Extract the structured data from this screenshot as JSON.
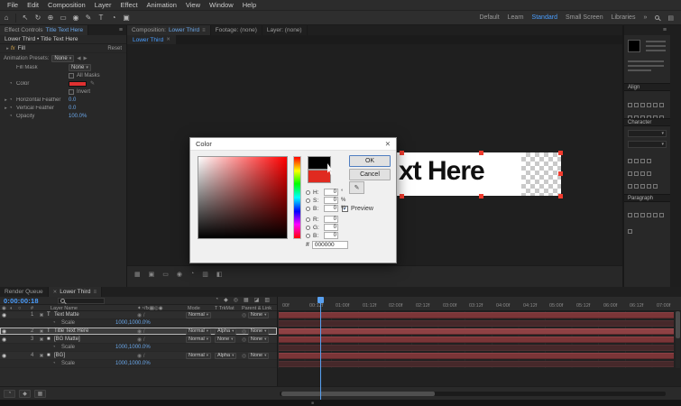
{
  "colors": {
    "accent": "#4a9eff",
    "fill_red": "#e03131",
    "dialog_current_red": "#e02a20",
    "timeline_bar": "#7b3537"
  },
  "icons": {
    "menu": "≡",
    "close": "✕",
    "dropdown": "▾",
    "twirl": "▸",
    "stopwatch": "◔",
    "eye": "◉",
    "audio": "◐",
    "solo": "○",
    "link": "◎",
    "prev": "◀",
    "next": "▶",
    "more": "»",
    "home": "⌂",
    "pointer": "↖",
    "rotate": "↻",
    "anchor": "⊕",
    "shape": "▭",
    "mask": "◉",
    "pen": "✎",
    "type": "T",
    "grid": "▣",
    "brush": "◔",
    "check": "✓",
    "eyedropper": "✎",
    "diamond": "◆",
    "box": "▦",
    "chart": "▥",
    "blend": "◧",
    "motion": "◪",
    "panel": "▤",
    "solid": "■"
  },
  "menubar": {
    "items": [
      "File",
      "Edit",
      "Composition",
      "Layer",
      "Effect",
      "Animation",
      "View",
      "Window",
      "Help"
    ]
  },
  "toolbar": {
    "workspaces": [
      "Default",
      "Learn",
      "Standard",
      "Small Screen",
      "Libraries"
    ],
    "active_workspace": "Standard"
  },
  "effect_controls": {
    "tab_label": "Effect Controls",
    "tab_target": "Title Text Here",
    "breadcrumb": "Lower Third • Title Text Here",
    "effect_badge": "fx",
    "effect_name": "Fill",
    "reset_label": "Reset",
    "presets_label": "Animation Presets:",
    "presets_value": "None",
    "props": {
      "fill_mask_label": "Fill Mask",
      "fill_mask_value": "None",
      "all_masks_label": "All Masks",
      "color_label": "Color",
      "invert_label": "Invert",
      "h_feather_label": "Horizontal Feather",
      "h_feather_value": "0.0",
      "v_feather_label": "Vertical Feather",
      "v_feather_value": "0.0",
      "opacity_label": "Opacity",
      "opacity_value": "100.0%"
    }
  },
  "comp_panel": {
    "tab_label": "Composition:",
    "tab_name": "Lower Third",
    "tab_footage": "Footage: (none)",
    "tab_layer": "Layer: (none)",
    "viewer_tab": "Lower Third",
    "canvas_text": "xt Here"
  },
  "right_panels": {
    "align": "Align",
    "character": "Character",
    "paragraph": "Paragraph"
  },
  "color_dialog": {
    "title": "Color",
    "ok": "OK",
    "cancel": "Cancel",
    "preview": "Preview",
    "hex_prefix": "#",
    "hex_value": "000000",
    "channels": [
      {
        "label": "H:",
        "value": "0",
        "unit": "°"
      },
      {
        "label": "S:",
        "value": "0",
        "unit": "%"
      },
      {
        "label": "B:",
        "value": "0",
        "unit": "%"
      },
      {
        "label": "R:",
        "value": "0",
        "unit": ""
      },
      {
        "label": "G:",
        "value": "0",
        "unit": ""
      },
      {
        "label": "B:",
        "value": "0",
        "unit": ""
      }
    ]
  },
  "timeline": {
    "tab_render_queue": "Render Queue",
    "tab_comp": "Lower Third",
    "timecode": "0:00:00:18",
    "columns": {
      "num": "#",
      "name": "Layer Name",
      "switches": "✦◔/fx▦◎◉",
      "mode": "Mode",
      "trkmat": "T TrkMat",
      "parent": "Parent & Link"
    },
    "row_switches": "◉ /",
    "layers": [
      {
        "num": "1",
        "icon": "T",
        "name": "Text Matte",
        "mode": "Normal",
        "trkmat": "",
        "parent": "None"
      },
      {
        "num": "2",
        "icon": "T",
        "name": "Title Text Here",
        "mode": "Normal",
        "trkmat": "Alpha",
        "parent": "None"
      },
      {
        "num": "3",
        "icon": "■",
        "name": "[BG Matte]",
        "mode": "Normal",
        "trkmat": "None",
        "parent": "None"
      },
      {
        "num": "4",
        "icon": "■",
        "name": "[BG]",
        "mode": "Normal",
        "trkmat": "Alpha",
        "parent": "None"
      }
    ],
    "scale_label": "Scale",
    "scale_value": "1000,1000.0%",
    "ruler": [
      "00f",
      "00:12f",
      "01:00f",
      "01:12f",
      "02:00f",
      "02:12f",
      "03:00f",
      "03:12f",
      "04:00f",
      "04:12f",
      "05:00f",
      "05:12f",
      "06:00f",
      "06:12f",
      "07:00f"
    ]
  }
}
